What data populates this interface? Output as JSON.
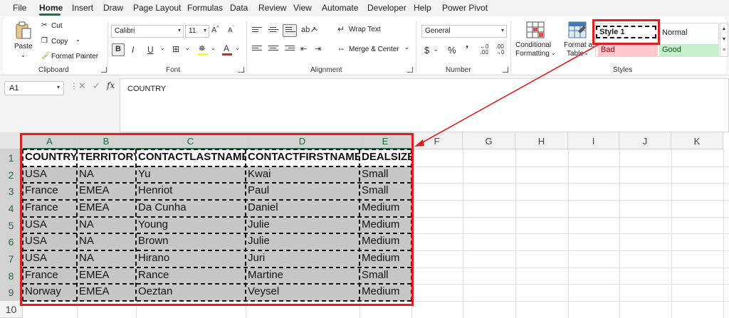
{
  "menu": [
    "File",
    "Home",
    "Insert",
    "Draw",
    "Page Layout",
    "Formulas",
    "Data",
    "Review",
    "View",
    "Automate",
    "Developer",
    "Help",
    "Power Pivot"
  ],
  "ribbon": {
    "clipboard": {
      "paste": "Paste",
      "cut": "Cut",
      "copy": "Copy",
      "format_painter": "Format Painter",
      "label": "Clipboard"
    },
    "font": {
      "name": "Calibri",
      "size": "11",
      "bold": "B",
      "italic": "I",
      "underline": "U",
      "label": "Font"
    },
    "alignment": {
      "wrap_text": "Wrap Text",
      "merge_center": "Merge & Center",
      "label": "Alignment"
    },
    "number": {
      "format": "General",
      "currency": "$",
      "percent": "%",
      "comma": "’",
      "label": "Number"
    },
    "styles": {
      "conditional_line1": "Conditional",
      "conditional_line2": "Formatting",
      "format_as_line1": "Format as",
      "format_as_line2": "Table",
      "style1": "Style 1",
      "normal": "Normal",
      "bad": "Bad",
      "good": "Good",
      "label": "Styles"
    }
  },
  "formula_bar": {
    "name_box": "A1",
    "fx": "fx",
    "formula": "COUNTRY"
  },
  "grid": {
    "columns": [
      "A",
      "B",
      "C",
      "D",
      "E",
      "F",
      "G",
      "H",
      "I",
      "J",
      "K"
    ],
    "rows": [
      "1",
      "2",
      "3",
      "4",
      "5",
      "6",
      "7",
      "8",
      "9",
      "10"
    ],
    "headers": [
      "COUNTRY",
      "TERRITORY",
      "CONTACTLASTNAME",
      "CONTACTFIRSTNAME",
      "DEALSIZE"
    ],
    "data": [
      [
        "USA",
        "NA",
        "Yu",
        "Kwai",
        "Small"
      ],
      [
        "France",
        "EMEA",
        "Henriot",
        "Paul",
        "Small"
      ],
      [
        "France",
        "EMEA",
        "Da Cunha",
        "Daniel",
        "Medium"
      ],
      [
        "USA",
        "NA",
        "Young",
        "Julie",
        "Medium"
      ],
      [
        "USA",
        "NA",
        "Brown",
        "Julie",
        "Medium"
      ],
      [
        "USA",
        "NA",
        "Hirano",
        "Juri",
        "Medium"
      ],
      [
        "France",
        "EMEA",
        "Rance",
        "Martine",
        "Small"
      ],
      [
        "Norway",
        "EMEA",
        "Oeztan",
        "Veysel",
        "Medium"
      ]
    ]
  },
  "colors": {
    "accent_green": "#1e7145",
    "highlight_red": "#e02020",
    "selection_gray": "#c6c6c6",
    "bad_fill": "#ffc7ce",
    "bad_text": "#9c0006",
    "good_fill": "#c6efce",
    "good_text": "#006100"
  }
}
